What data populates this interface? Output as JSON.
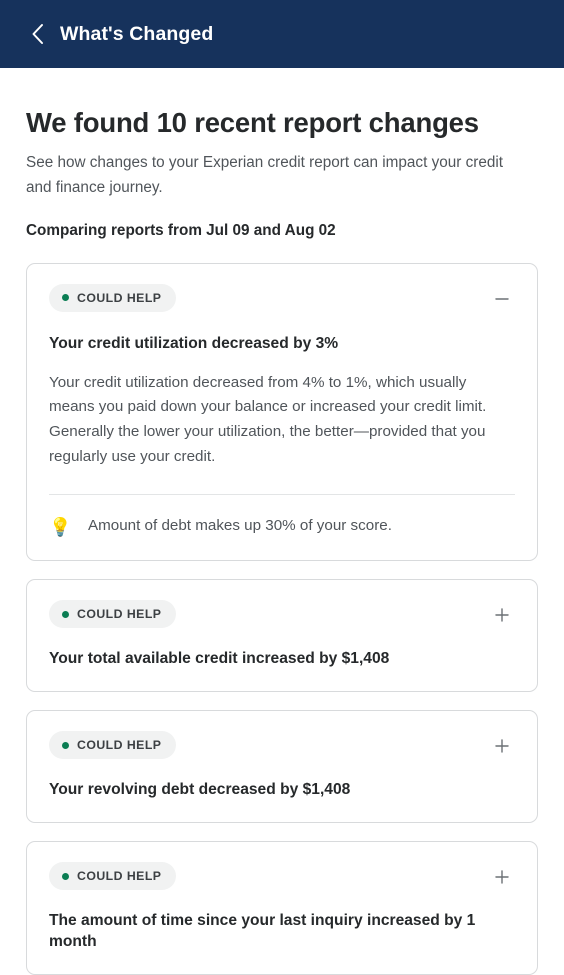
{
  "header": {
    "title": "What's Changed",
    "back_icon": "chevron-left-icon",
    "background_color": "#16325c"
  },
  "main": {
    "page_title": "We found 10 recent report changes",
    "subtitle": "See how changes to your Experian credit report can impact your credit and finance journey.",
    "comparison_line": "Comparing reports from Jul 09 and Aug 02",
    "change_count": 10,
    "compare_date_from": "Jul 09",
    "compare_date_to": "Aug 02"
  },
  "colors": {
    "navy": "#16325c",
    "badge_background": "#f1f2f2",
    "badge_dot_green": "#0b7d53",
    "card_border": "#d8dadc",
    "body_text": "#50555a",
    "heading_text": "#26292b"
  },
  "cards": [
    {
      "badge": "COULD HELP",
      "badge_dot": "status-dot-green",
      "heading": "Your credit utilization decreased by 3%",
      "expanded": true,
      "toggle_icon": "minus-icon",
      "body": "Your credit utilization decreased from 4% to 1%, which usually means you paid down your balance or increased your credit limit. Generally the lower your utilization, the better—provided that you regularly use your credit.",
      "tip_icon": "lightbulb-icon",
      "tip_emoji": "💡",
      "tip_text": "Amount of debt makes up 30% of your score."
    },
    {
      "badge": "COULD HELP",
      "badge_dot": "status-dot-green",
      "heading": "Your total available credit increased by $1,408",
      "expanded": false,
      "toggle_icon": "plus-icon"
    },
    {
      "badge": "COULD HELP",
      "badge_dot": "status-dot-green",
      "heading": "Your revolving debt decreased by $1,408",
      "expanded": false,
      "toggle_icon": "plus-icon"
    },
    {
      "badge": "COULD HELP",
      "badge_dot": "status-dot-green",
      "heading": "The amount of time since your last inquiry increased by 1 month",
      "expanded": false,
      "toggle_icon": "plus-icon"
    }
  ]
}
